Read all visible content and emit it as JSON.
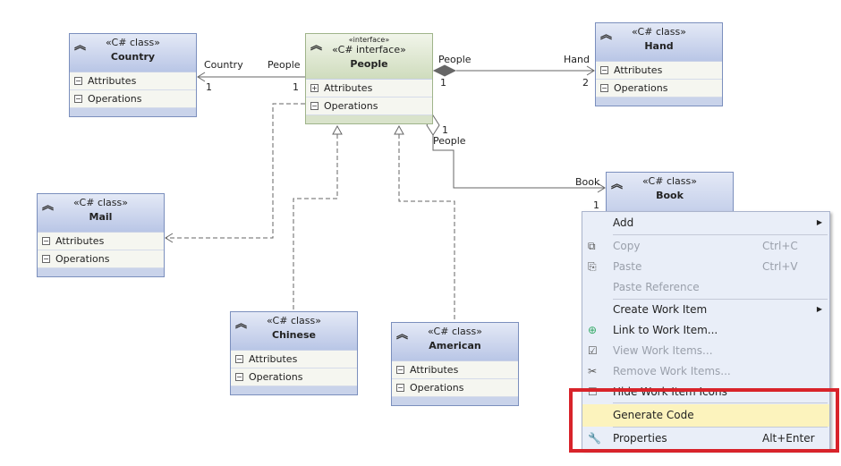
{
  "classes": {
    "country": {
      "stereotype": "«C# class»",
      "name": "Country",
      "attributes": "Attributes",
      "operations": "Operations"
    },
    "people": {
      "stereotype_small": "«interface»",
      "stereotype": "«C# interface»",
      "name": "People",
      "attributes": "Attributes",
      "operations": "Operations"
    },
    "hand": {
      "stereotype": "«C# class»",
      "name": "Hand",
      "attributes": "Attributes",
      "operations": "Operations"
    },
    "mail": {
      "stereotype": "«C# class»",
      "name": "Mail",
      "attributes": "Attributes",
      "operations": "Operations"
    },
    "chinese": {
      "stereotype": "«C# class»",
      "name": "Chinese",
      "attributes": "Attributes",
      "operations": "Operations"
    },
    "american": {
      "stereotype": "«C# class»",
      "name": "American",
      "attributes": "Attributes",
      "operations": "Operations"
    },
    "book": {
      "stereotype": "«C# class»",
      "name": "Book"
    }
  },
  "labels": {
    "country_role": "Country",
    "country_mult": "1",
    "people_role1": "People",
    "people_mult1": "1",
    "people_role2": "People",
    "people_mult2": "1",
    "hand_role": "Hand",
    "hand_mult": "2",
    "people_mult3": "1",
    "people_role3": "People",
    "book_role": "Book",
    "book_mult": "1"
  },
  "menu": {
    "items": [
      {
        "label": "Add",
        "submenu": true
      },
      {
        "label": "Copy",
        "shortcut": "Ctrl+C",
        "disabled": true
      },
      {
        "label": "Paste",
        "shortcut": "Ctrl+V",
        "disabled": true
      },
      {
        "label": "Paste Reference",
        "disabled": true
      },
      {
        "label": "Create Work Item",
        "submenu": true
      },
      {
        "label": "Link to Work Item..."
      },
      {
        "label": "View Work Items...",
        "disabled": true
      },
      {
        "label": "Remove Work Items...",
        "disabled": true
      },
      {
        "label": "Hide Work Item Icons"
      },
      {
        "label": "Generate Code",
        "highlighted": true
      },
      {
        "label": "Properties",
        "shortcut": "Alt+Enter"
      }
    ]
  },
  "colors": {
    "highlight_box": "#d8232a",
    "menu_highlight": "#fcf3bd"
  }
}
